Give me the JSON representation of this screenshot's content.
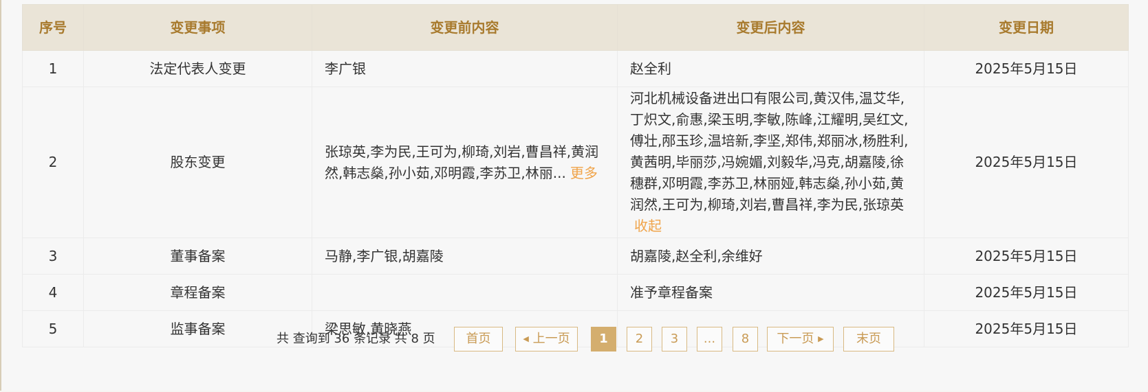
{
  "table": {
    "headers": [
      "序号",
      "变更事项",
      "变更前内容",
      "变更后内容",
      "变更日期"
    ],
    "rows": [
      {
        "no": "1",
        "item": "法定代表人变更",
        "before": "李广银",
        "after": "赵全利",
        "date": "2025年5月15日"
      },
      {
        "no": "2",
        "item": "股东变更",
        "before": "张琼英,李为民,王可为,柳琦,刘岩,曹昌祥,黄润然,韩志燊,孙小茹,邓明霞,李苏卫,林丽...",
        "before_more": "更多",
        "after": "河北机械设备进出口有限公司,黄汉伟,温艾华,丁炽文,俞惠,梁玉明,李敏,陈峰,江耀明,吴红文,傅壮,邴玉珍,温培新,李坚,郑伟,郑丽冰,杨胜利,黄茜明,毕丽莎,冯婉媚,刘毅华,冯克,胡嘉陵,徐穗群,邓明霞,李苏卫,林丽娅,韩志燊,孙小茹,黄润然,王可为,柳琦,刘岩,曹昌祥,李为民,张琼英",
        "after_collapse": "收起",
        "date": "2025年5月15日"
      },
      {
        "no": "3",
        "item": "董事备案",
        "before": "马静,李广银,胡嘉陵",
        "after": "胡嘉陵,赵全利,余维好",
        "date": "2025年5月15日"
      },
      {
        "no": "4",
        "item": "章程备案",
        "before": "",
        "after": "准予章程备案",
        "date": "2025年5月15日"
      },
      {
        "no": "5",
        "item": "监事备案",
        "before": "梁思敏,黄晓燕",
        "after": "",
        "date": "2025年5月15日"
      }
    ]
  },
  "pagination": {
    "summary": "共 查询到 36 条记录 共 8 页",
    "first": "首页",
    "prev": "上一页",
    "pages": [
      "1",
      "2",
      "3",
      "...",
      "8"
    ],
    "current": "1",
    "next": "下一页",
    "last": "末页"
  },
  "colors": {
    "header_bg": "#eae4d7",
    "header_text": "#a87a2d",
    "link": "#f0a44a",
    "page_active": "#d4ae6e",
    "page_border": "#d8b982"
  }
}
